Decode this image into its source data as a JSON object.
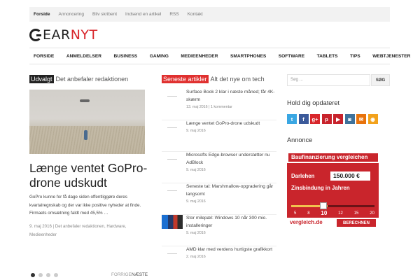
{
  "topbar": {
    "items": [
      "Forside",
      "Annoncering",
      "Bliv skribent",
      "Indsend en artikel",
      "RSS",
      "Kontakt"
    ]
  },
  "logo": {
    "text_a": "EAR",
    "text_b": "NYT"
  },
  "nav": {
    "items": [
      "FORSIDE",
      "ANMELDELSER",
      "BUSINESS",
      "GAMING",
      "MEDIEENHEDER",
      "SMARTPHONES",
      "SOFTWARE",
      "TABLETS",
      "TIPS",
      "WEBTJENESTER"
    ]
  },
  "featured": {
    "tag": "Udvalgt",
    "subtitle": "Det anbefaler redaktionen",
    "title": "Længe ventet GoPro-drone udskudt",
    "excerpt": "GoPro kunne for få dage siden offentliggøre deres kvartalregnskab og der var ikke positive nyheder at finde. Firmaets omsætning faldt med 45,5% …",
    "meta": "9. maj 2016 | Det anbefaler redaktionen, Hardware, Medieenheder",
    "prev_label": "FORRIGE",
    "next_label": "NÆSTE"
  },
  "latest": {
    "tag": "Seneste artikler",
    "subtitle": "Alt det nye om tech",
    "articles": [
      {
        "title": "Surface Book 2 klar i næste måned; får 4K-skærm",
        "meta": "13. maj 2016 | 1 kommentar"
      },
      {
        "title": "Længe ventet GoPro-drone udskudt",
        "meta": "9. maj 2016"
      },
      {
        "title": "Microsofts Edge-browser understøtter nu AdBlock",
        "meta": "9. maj 2016"
      },
      {
        "title": "Seneste tal: Marshmallow-opgradering går langsomt",
        "meta": "9. maj 2016"
      },
      {
        "title": "Stor milepæl: Windows 10 når 300 mio. installeringer",
        "meta": "9. maj 2016"
      },
      {
        "title": "AMD klar med verdens hurtigste grafikkort",
        "meta": "2. maj 2016"
      }
    ]
  },
  "sidebar": {
    "search_placeholder": "Søg ...",
    "search_button": "SØG",
    "follow_heading": "Hold dig opdateret",
    "social_icons": [
      "twitter-icon",
      "facebook-icon",
      "google-plus-icon",
      "pinterest-icon",
      "youtube-icon",
      "instagram-icon",
      "email-icon",
      "rss-icon"
    ],
    "social_glyphs": [
      "t",
      "f",
      "g+",
      "p",
      "▶",
      "◙",
      "✉",
      "◉"
    ],
    "ad_heading": "Annonce"
  },
  "ad": {
    "title": "Baufinanzierung vergleichen",
    "loan_label": "Darlehen",
    "loan_value": "150.000 €",
    "term_label": "Zinsbindung in Jahren",
    "term_ticks": [
      "5",
      "8",
      "10",
      "12",
      "15",
      "20"
    ],
    "term_selected": "10",
    "brand": "vergleich.de",
    "cta": "BERECHNEN"
  },
  "colors": {
    "brand_red": "#d8262b",
    "tag_dark": "#222222",
    "tag_red": "#e0302f",
    "twitter": "#3aa7e3",
    "facebook": "#3b5a9a",
    "google": "#d8262b",
    "pinterest": "#c8232c",
    "youtube": "#c8232c",
    "instagram": "#3f729b",
    "email": "#e8730c",
    "rss": "#f2a21c"
  }
}
